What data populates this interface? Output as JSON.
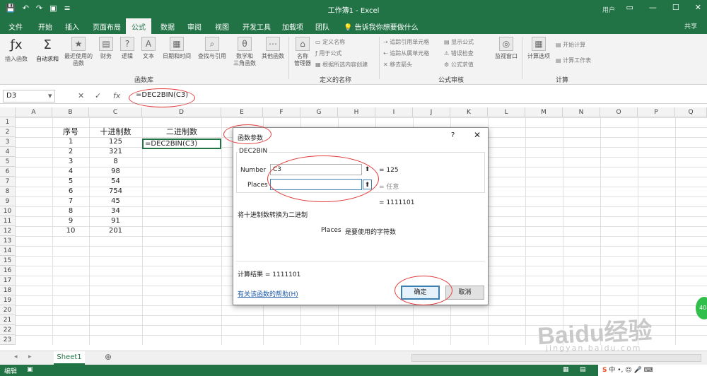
{
  "window": {
    "title": "工作簿1 - Excel",
    "user": "用户",
    "share": "共享"
  },
  "tabs": [
    "文件",
    "开始",
    "插入",
    "页面布局",
    "公式",
    "数据",
    "审阅",
    "视图",
    "开发工具",
    "加载项",
    "团队"
  ],
  "tell_me": "告诉我你想要做什么",
  "ribbon": {
    "insert_fn": "插入函数",
    "autosum": "自动求和",
    "recent": "最近使用的\n函数",
    "financial": "财务",
    "logical": "逻辑",
    "text": "文本",
    "datetime": "日期和时间",
    "lookup": "查找与引用",
    "math": "数学和\n三角函数",
    "other": "其他函数",
    "name_mgr": "名称\n管理器",
    "define_name": "定义名称",
    "use_in_formula": "用于公式",
    "create_from_sel": "根据所选内容创建",
    "trace_precedents": "追踪引用单元格",
    "trace_dependents": "追踪从属单元格",
    "remove_arrows": "移去箭头",
    "show_formulas": "显示公式",
    "error_check": "错误检查",
    "evaluate": "公式求值",
    "watch": "监视窗口",
    "calc_options": "计算选项",
    "calc_now": "开始计算",
    "calc_sheet": "计算工作表",
    "groups": {
      "library": "函数库",
      "names": "定义的名称",
      "audit": "公式审核",
      "calc": "计算"
    }
  },
  "formula_bar": {
    "name_box": "D3",
    "formula": "=DEC2BIN(C3)"
  },
  "columns": [
    "A",
    "B",
    "C",
    "D",
    "E",
    "F",
    "G",
    "H",
    "I",
    "J",
    "K",
    "L",
    "M",
    "N",
    "O",
    "P",
    "Q"
  ],
  "rows": [
    "1",
    "2",
    "3",
    "4",
    "5",
    "6",
    "7",
    "8",
    "9",
    "10",
    "11",
    "12",
    "13",
    "14",
    "15",
    "16",
    "17",
    "18",
    "19",
    "20",
    "21",
    "22",
    "23"
  ],
  "table": {
    "headers": [
      "序号",
      "十进制数",
      "二进制数"
    ],
    "serial": [
      "1",
      "2",
      "3",
      "4",
      "5",
      "6",
      "7",
      "8",
      "9",
      "10"
    ],
    "decimal": [
      "125",
      "321",
      "8",
      "98",
      "54",
      "754",
      "45",
      "34",
      "91",
      "201"
    ],
    "active_cell": "=DEC2BIN(C3)"
  },
  "sheet_tab": "Sheet1",
  "status": "编辑",
  "dialog": {
    "title": "函数参数",
    "help_q": "?",
    "close": "✕",
    "func_name": "DEC2BIN",
    "arg1_label": "Number",
    "arg1_value": "C3",
    "arg1_result": "= 125",
    "arg2_label": "Places",
    "arg2_value": "",
    "arg2_result": "= 任意",
    "total_result": "= 1111101",
    "description": "将十进制数转换为二进制",
    "arg_desc_name": "Places",
    "arg_desc": "是要使用的字符数",
    "calc_result": "计算结果 =  1111101",
    "help_link": "有关该函数的帮助(H)",
    "ok": "确定",
    "cancel": "取消"
  },
  "watermark": {
    "brand": "Baidu经验",
    "url": "jingyan.baidu.com"
  }
}
